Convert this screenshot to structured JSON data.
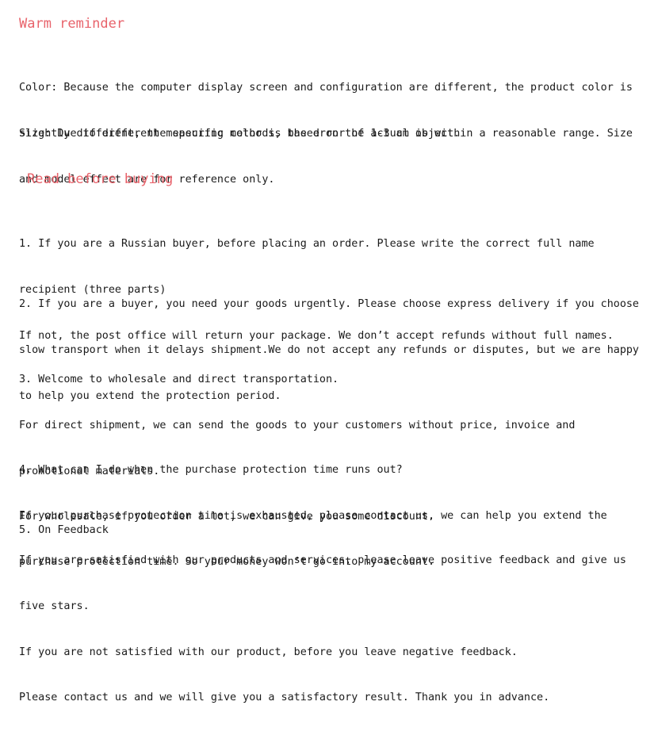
{
  "document": {
    "background_color": "#ffffff",
    "text_color": "#1a1a1a",
    "heading_color": "#e8636b"
  },
  "headings": {
    "warm_reminder": "Warm reminder",
    "read_before_buying": "Read before buying"
  },
  "reminder": {
    "color_note": [
      "Color: Because the computer display screen and configuration are different, the product color is",
      "slightly different, the specific color is based on the actual object."
    ],
    "size_note": [
      "Size: Due to different measuring methods, the error of 1-3 cm is within a reasonable range. Size",
      "and model effect are for reference only."
    ]
  },
  "buying_notes": {
    "item1": [
      "1. If you are a Russian buyer, before placing an order. Please write the correct full name",
      "recipient (three parts)",
      "If not, the post office will return your package. We don’t accept refunds without full names."
    ],
    "item2": [
      "2. If you are a buyer, you need your goods urgently. Please choose express delivery if you choose",
      "slow transport when it delays shipment.We do not accept any refunds or disputes, but we are happy",
      "to help you extend the protection period."
    ],
    "item3": [
      "3. Welcome to wholesale and direct transportation.",
      "For direct shipment, we can send the goods to your customers without price, invoice and",
      "promotional materials.",
      "For wholesale, if you order a lot, we can give you some discount."
    ],
    "item4": [
      "4. What can I do when the purchase protection time runs out?",
      "If your purchase protection time is exhausted, please contact us, we can help you extend the",
      "purchase protection time. So your money won’t go into my account."
    ],
    "item5_heading": "5. On Feedback",
    "item5_body": [
      "If you are satisfied with our products and services, please leave positive feedback and give us",
      "five stars.",
      "If you are not satisfied with our product, before you leave negative feedback.",
      "Please contact us and we will give you a satisfactory result. Thank you in advance."
    ]
  }
}
